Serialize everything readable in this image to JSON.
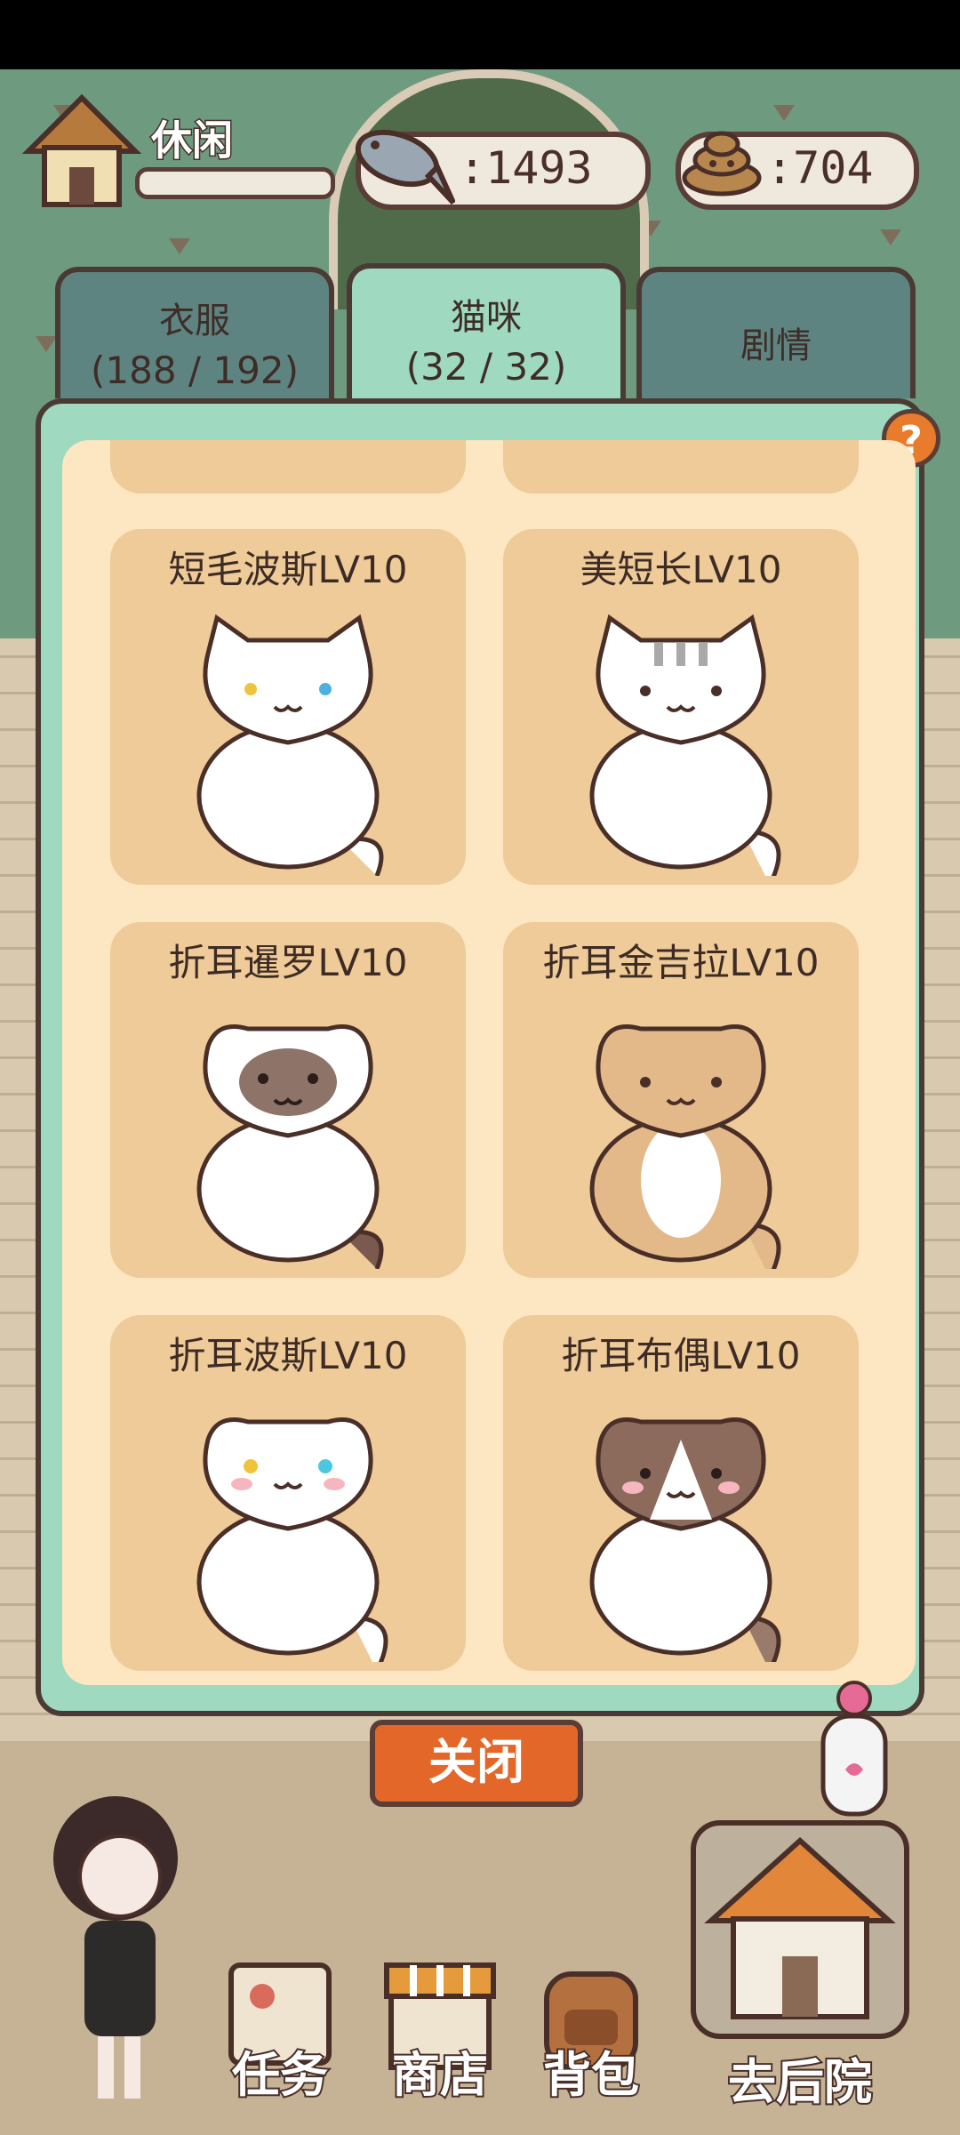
{
  "status": {
    "house_label": "休闲",
    "fish_count": "1493",
    "poop_count": "704",
    "fish_prefix": ":",
    "poop_prefix": ":"
  },
  "tabs": [
    {
      "label": "衣服",
      "count": "(188 / 192)",
      "active": false
    },
    {
      "label": "猫咪",
      "count": "(32 / 32)",
      "active": true
    },
    {
      "label": "剧情",
      "count": "",
      "active": false
    }
  ],
  "help_label": "?",
  "cards": [
    {
      "name": "短毛波斯LV10",
      "icon": "white-persian-cat"
    },
    {
      "name": "美短长LV10",
      "icon": "silver-tabby-cat"
    },
    {
      "name": "折耳暹罗LV10",
      "icon": "siamese-fold-cat"
    },
    {
      "name": "折耳金吉拉LV10",
      "icon": "golden-chinchilla-fold-cat"
    },
    {
      "name": "折耳波斯LV10",
      "icon": "white-persian-fold-cat"
    },
    {
      "name": "折耳布偶LV10",
      "icon": "ragdoll-fold-cat"
    }
  ],
  "close_label": "关闭",
  "nav": [
    {
      "label": "任务",
      "icon": "task-board-icon"
    },
    {
      "label": "商店",
      "icon": "shop-icon"
    },
    {
      "label": "背包",
      "icon": "backpack-icon"
    },
    {
      "label": "去后院",
      "icon": "backyard-house-icon"
    }
  ],
  "colors": {
    "panel": "#9ed9c0",
    "panel_inner": "#fde6c2",
    "card": "#eecb98",
    "close_button": "#e4672a",
    "outline": "#4a3a33"
  }
}
